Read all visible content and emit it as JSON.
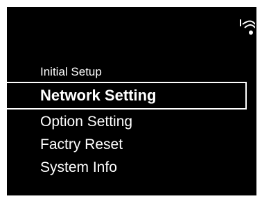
{
  "status": {
    "wifi_icon": "wifi-signal-icon"
  },
  "menu": {
    "items": [
      {
        "label": "Initial Setup"
      },
      {
        "label": "Network Setting",
        "selected": true
      },
      {
        "label": "Option Setting"
      },
      {
        "label": "Factry Reset"
      },
      {
        "label": "System Info"
      }
    ]
  },
  "colors": {
    "background": "#000000",
    "text": "#ffffff",
    "selection_border": "#ffffff"
  }
}
